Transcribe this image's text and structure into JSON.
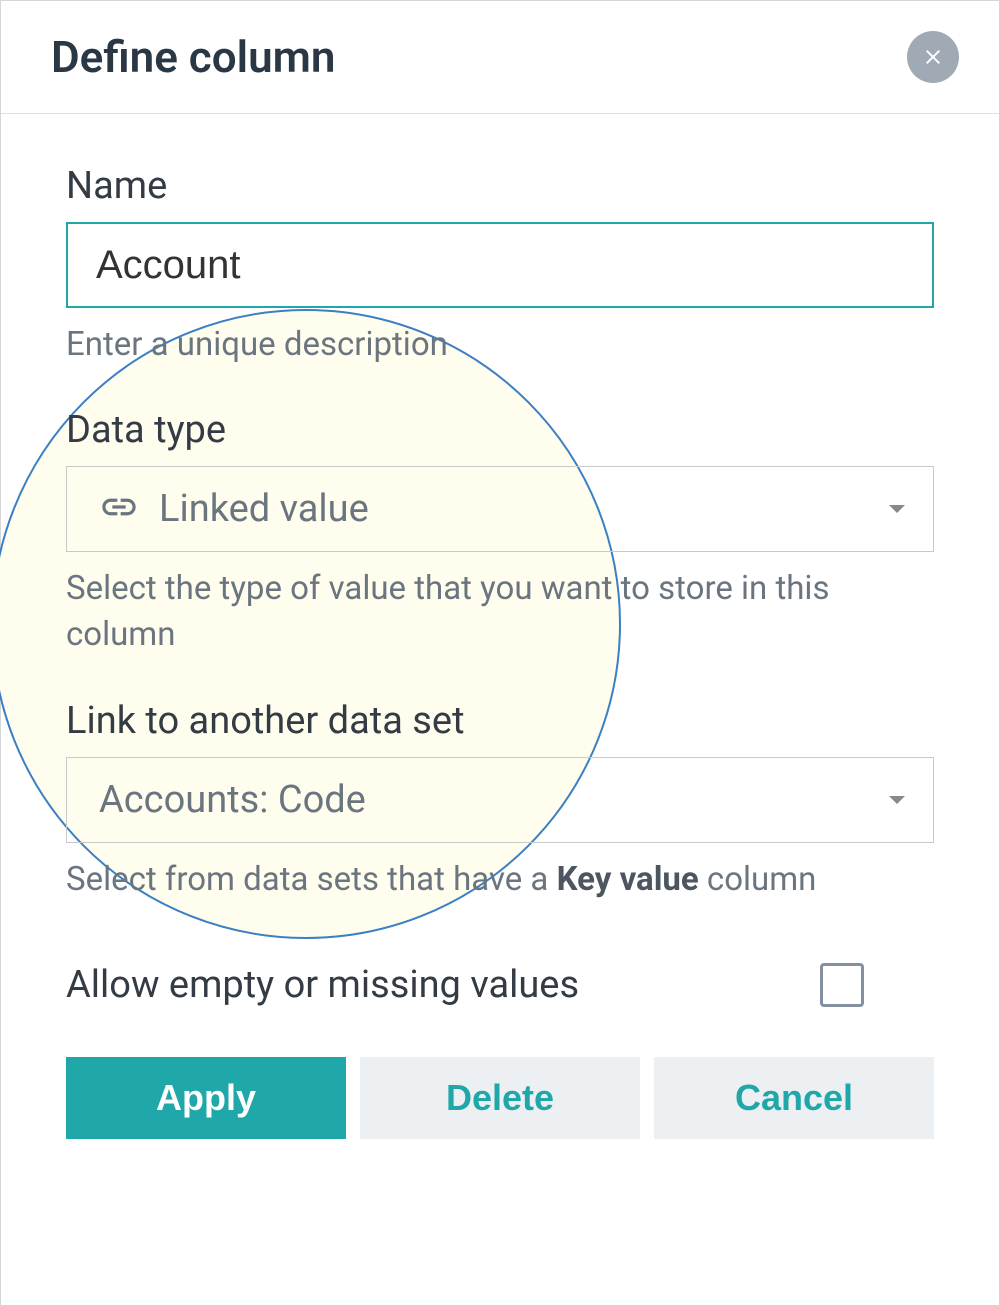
{
  "header": {
    "title": "Define column"
  },
  "fields": {
    "name": {
      "label": "Name",
      "value": "Account",
      "helper": "Enter a unique description"
    },
    "dataType": {
      "label": "Data type",
      "value": "Linked value",
      "helper": "Select the type of value that you want to store in this column",
      "icon": "link-icon"
    },
    "linkDataset": {
      "label": "Link to another data set",
      "value": "Accounts: Code",
      "helperPrefix": "Select from data sets that have a ",
      "helperBold": "Key value",
      "helperSuffix": " column"
    },
    "allowEmpty": {
      "label": "Allow empty or missing values",
      "checked": false
    }
  },
  "buttons": {
    "apply": "Apply",
    "delete": "Delete",
    "cancel": "Cancel"
  }
}
